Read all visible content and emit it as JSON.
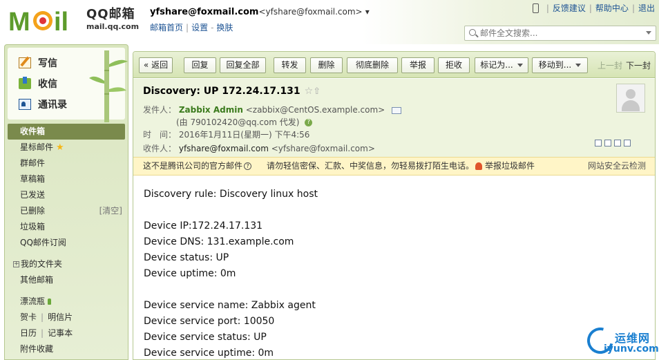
{
  "header": {
    "logo_alt": "Mail",
    "brand_cn": "QQ邮箱",
    "brand_domain": "mail.qq.com",
    "account_email": "yfshare@foxmail.com",
    "account_alias": "<yfshare@foxmail.com>",
    "alias_caret": "▾",
    "links": [
      "邮箱首页",
      "设置",
      "换肤"
    ],
    "top_links": [
      "反馈建议",
      "帮助中心",
      "退出"
    ],
    "search_placeholder": "邮件全文搜索..."
  },
  "sidebar": {
    "actions": [
      "写信",
      "收信",
      "通讯录"
    ],
    "folders": [
      "收件箱",
      "星标邮件",
      "群邮件",
      "草稿箱",
      "已发送",
      "已删除",
      "垃圾箱",
      "QQ邮件订阅"
    ],
    "star_glyph": "★",
    "clear_label": "[清空]",
    "my_folders": "我的文件夹",
    "other_mail": "其他邮箱",
    "drift_bottle": "漂流瓶",
    "greeting_card": "贺卡",
    "postcard": "明信片",
    "calendar": "日历",
    "notepad": "记事本",
    "attachments": "附件收藏"
  },
  "toolbar": {
    "back": "« 返回",
    "reply": "回复",
    "reply_all": "回复全部",
    "forward": "转发",
    "delete": "删除",
    "perm_delete": "彻底删除",
    "report": "举报",
    "reject": "拒收",
    "mark_as": "标记为...",
    "move_to": "移动到...",
    "prev": "上一封",
    "next": "下一封"
  },
  "mail": {
    "subject": "Discovery: UP 172.24.17.131",
    "sender_label": "发件人：",
    "sender_name": "Zabbix Admin",
    "sender_addr": "<zabbix@CentOS.example.com>",
    "proxy_note": "(由 790102420@qq.com 代发)",
    "time_label": "时　间：",
    "time_value": "2016年1月11日(星期一) 下午4:56",
    "to_label": "收件人：",
    "to_name": "yfshare@foxmail.com",
    "to_addr": "<yfshare@foxmail.com>"
  },
  "warning": {
    "official": "这不是腾讯公司的官方邮件",
    "advice": "请勿轻信密保、汇款、中奖信息，勿轻易拨打陌生电话。",
    "report_spam": "举报垃圾邮件",
    "cloud_check": "网站安全云检测"
  },
  "body_lines": [
    "Discovery rule: Discovery linux host",
    "",
    "Device IP:172.24.17.131",
    "Device DNS: 131.example.com",
    "Device status: UP",
    "Device uptime: 0m",
    "",
    "Device service name: Zabbix agent",
    "Device service port: 10050",
    "Device service status: UP",
    "Device service uptime: 0m"
  ],
  "watermark": {
    "cn": "运维网",
    "en": "iyunv.com"
  }
}
